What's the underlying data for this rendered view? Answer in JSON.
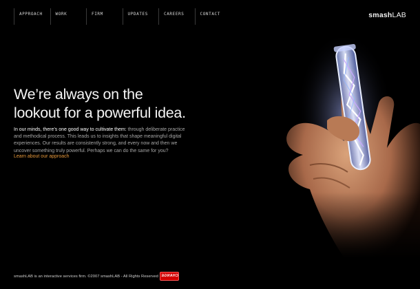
{
  "nav": {
    "items": [
      {
        "label": "APPROACH"
      },
      {
        "label": "WORK"
      },
      {
        "label": "FIRM"
      },
      {
        "label": "UPDATES"
      },
      {
        "label": "CAREERS"
      },
      {
        "label": "CONTACT"
      }
    ]
  },
  "brand": {
    "logo_bold": "smash",
    "logo_light": "LAB"
  },
  "hero": {
    "headline_line1": "We’re always on the",
    "headline_line2": "lookout for a powerful idea.",
    "intro_highlight": "In our minds, there’s one good way to cultivate them:",
    "intro_rest": "through deliberate practice and methodical process. This leads us to insights that shape meaningful digital experiences. Our results are consistently strong, and every now and then we uncover something truly powerful. Perhaps we can do the same for you?",
    "cta_link": "Learn about our approach",
    "image_icon": "hand-holding-test-tube-lightning"
  },
  "footer": {
    "text": "smashLAB is an interactive services firm. ©2007 smashLAB - All Rights Reserved",
    "badge_label": "CHANGE"
  },
  "colors": {
    "background": "#000000",
    "link": "#e6983b",
    "badge": "#d20000"
  }
}
